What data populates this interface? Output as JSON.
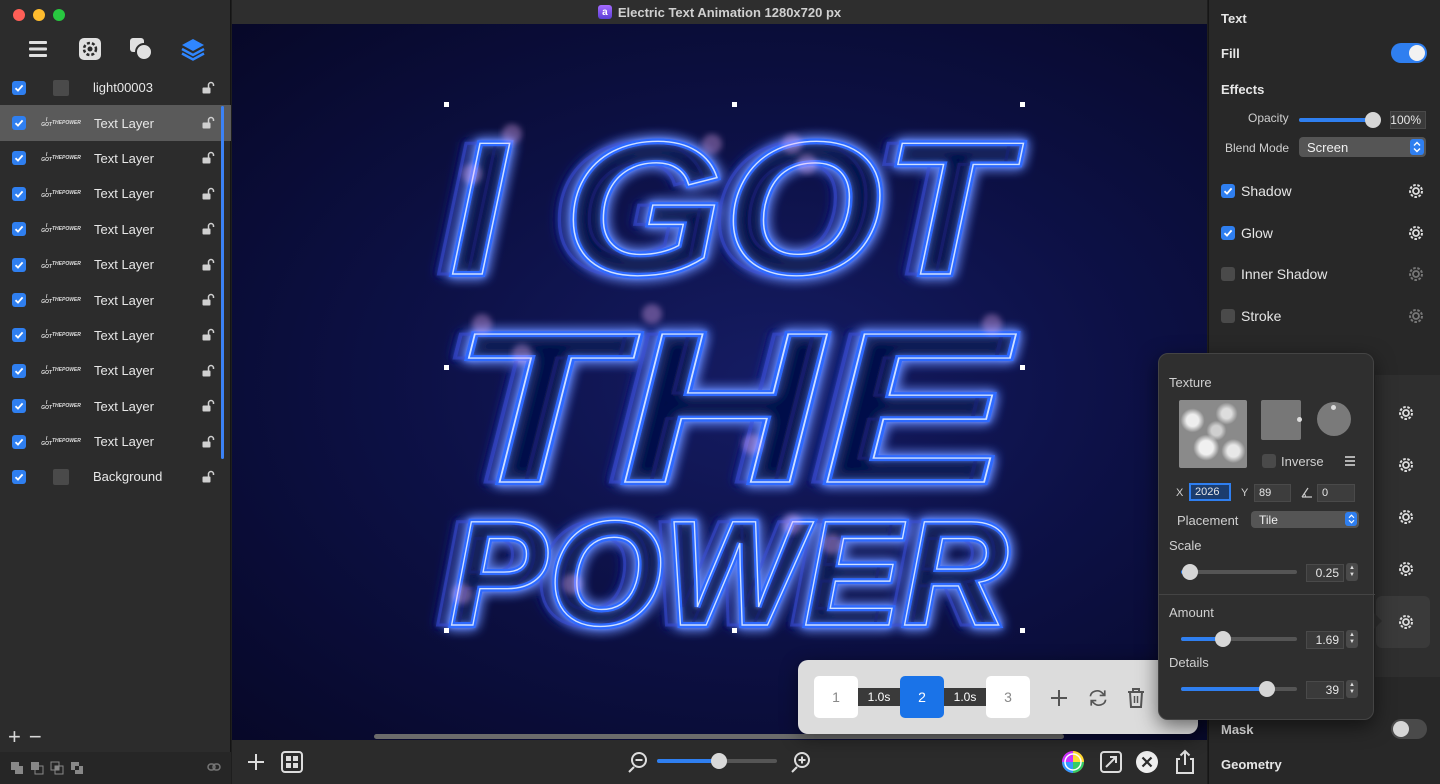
{
  "window": {
    "title": "Electric Text Animation 1280x720 px"
  },
  "sidebar": {
    "tools": [
      "list-icon",
      "gear-icon",
      "shapes-icon",
      "layers-icon"
    ],
    "layers": [
      {
        "name": "light00003",
        "checked": true,
        "thumb": "plain",
        "selected": false
      },
      {
        "name": "Text Layer",
        "checked": true,
        "thumb": "text",
        "selected": true
      },
      {
        "name": "Text Layer",
        "checked": true,
        "thumb": "text",
        "selected": false
      },
      {
        "name": "Text Layer",
        "checked": true,
        "thumb": "text",
        "selected": false
      },
      {
        "name": "Text Layer",
        "checked": true,
        "thumb": "text",
        "selected": false
      },
      {
        "name": "Text Layer",
        "checked": true,
        "thumb": "text",
        "selected": false
      },
      {
        "name": "Text Layer",
        "checked": true,
        "thumb": "text",
        "selected": false
      },
      {
        "name": "Text Layer",
        "checked": true,
        "thumb": "text",
        "selected": false
      },
      {
        "name": "Text Layer",
        "checked": true,
        "thumb": "text",
        "selected": false
      },
      {
        "name": "Text Layer",
        "checked": true,
        "thumb": "text",
        "selected": false
      },
      {
        "name": "Text Layer",
        "checked": true,
        "thumb": "text",
        "selected": false
      },
      {
        "name": "Background",
        "checked": true,
        "thumb": "plain",
        "selected": false
      }
    ],
    "thumb_text": [
      "I GOT",
      "THE",
      "POWER"
    ],
    "add_label": "+",
    "remove_label": "−"
  },
  "canvas": {
    "text_lines": [
      "I GOT",
      "THE",
      "POWER"
    ],
    "glow_color": "#2f6bff",
    "background_color": "#0d1147"
  },
  "keyframes": {
    "frames": [
      {
        "label": "1",
        "active": false
      },
      {
        "label": "2",
        "active": true
      },
      {
        "label": "3",
        "active": false
      }
    ],
    "durations": [
      "1.0s",
      "1.0s"
    ]
  },
  "zoom": {
    "level": 0.52
  },
  "inspector": {
    "section_text": "Text",
    "fill_label": "Fill",
    "fill_on": true,
    "effects_label": "Effects",
    "opacity_label": "Opacity",
    "opacity_value": "100%",
    "opacity_level": 1.0,
    "blend_label": "Blend Mode",
    "blend_value": "Screen",
    "effects": [
      {
        "label": "Shadow",
        "checked": true
      },
      {
        "label": "Glow",
        "checked": true
      },
      {
        "label": "Inner Shadow",
        "checked": false
      },
      {
        "label": "Stroke",
        "checked": false
      }
    ],
    "mask_label": "Mask",
    "mask_on": false,
    "geometry_label": "Geometry"
  },
  "texture_popover": {
    "title": "Texture",
    "inverse_label": "Inverse",
    "inverse_checked": false,
    "x_label": "X",
    "x_value": "2026",
    "y_label": "Y",
    "y_value": "89",
    "angle_value": "0",
    "placement_label": "Placement",
    "placement_value": "Tile",
    "scale_label": "Scale",
    "scale_value": "0.25",
    "scale_level": 0.08,
    "amount_label": "Amount",
    "amount_value": "1.69",
    "amount_level": 0.36,
    "details_label": "Details",
    "details_value": "39",
    "details_level": 0.74
  }
}
